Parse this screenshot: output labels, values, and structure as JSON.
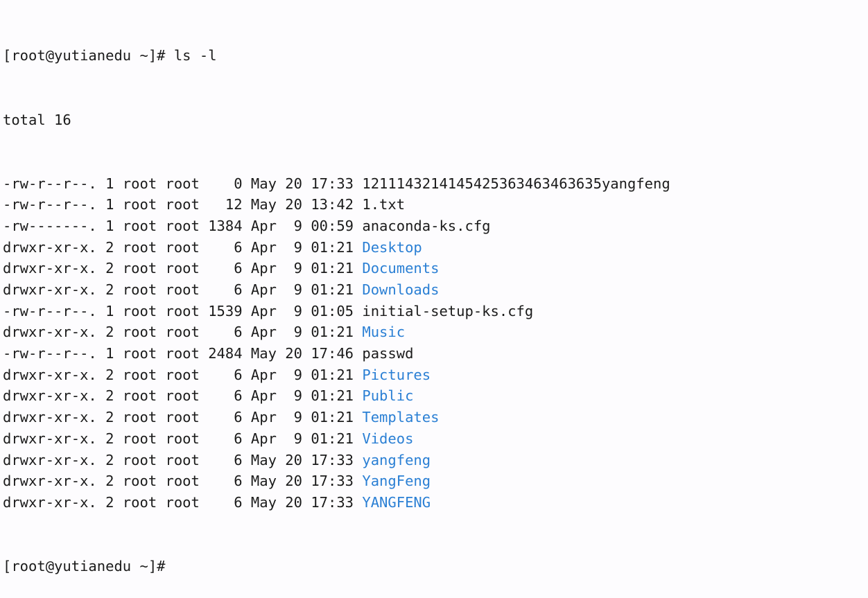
{
  "terminal": {
    "colors": {
      "background": "#fdfcfe",
      "foreground": "#1b1b1b",
      "directory": "#2a7fd4"
    },
    "prompt": "[root@yutianedu ~]#",
    "user": "root",
    "host": "yutianedu",
    "cwd": "~",
    "command": "ls -l",
    "command_line": "[root@yutianedu ~]# ls -l",
    "total_line": "total 16",
    "total_blocks": "16",
    "columns": [
      "permissions",
      "links",
      "owner",
      "group",
      "size",
      "month",
      "day",
      "time",
      "name"
    ],
    "entries": [
      {
        "permissions": "-rw-r--r--.",
        "links": "1",
        "owner": "root",
        "group": "root",
        "size": "0",
        "month": "May",
        "day": "20",
        "time": "17:33",
        "name": "1211143214145425363463463635yangfeng",
        "type": "file"
      },
      {
        "permissions": "-rw-r--r--.",
        "links": "1",
        "owner": "root",
        "group": "root",
        "size": "12",
        "month": "May",
        "day": "20",
        "time": "13:42",
        "name": "1.txt",
        "type": "file"
      },
      {
        "permissions": "-rw-------.",
        "links": "1",
        "owner": "root",
        "group": "root",
        "size": "1384",
        "month": "Apr",
        "day": "9",
        "time": "00:59",
        "name": "anaconda-ks.cfg",
        "type": "file"
      },
      {
        "permissions": "drwxr-xr-x.",
        "links": "2",
        "owner": "root",
        "group": "root",
        "size": "6",
        "month": "Apr",
        "day": "9",
        "time": "01:21",
        "name": "Desktop",
        "type": "dir"
      },
      {
        "permissions": "drwxr-xr-x.",
        "links": "2",
        "owner": "root",
        "group": "root",
        "size": "6",
        "month": "Apr",
        "day": "9",
        "time": "01:21",
        "name": "Documents",
        "type": "dir"
      },
      {
        "permissions": "drwxr-xr-x.",
        "links": "2",
        "owner": "root",
        "group": "root",
        "size": "6",
        "month": "Apr",
        "day": "9",
        "time": "01:21",
        "name": "Downloads",
        "type": "dir"
      },
      {
        "permissions": "-rw-r--r--.",
        "links": "1",
        "owner": "root",
        "group": "root",
        "size": "1539",
        "month": "Apr",
        "day": "9",
        "time": "01:05",
        "name": "initial-setup-ks.cfg",
        "type": "file"
      },
      {
        "permissions": "drwxr-xr-x.",
        "links": "2",
        "owner": "root",
        "group": "root",
        "size": "6",
        "month": "Apr",
        "day": "9",
        "time": "01:21",
        "name": "Music",
        "type": "dir"
      },
      {
        "permissions": "-rw-r--r--.",
        "links": "1",
        "owner": "root",
        "group": "root",
        "size": "2484",
        "month": "May",
        "day": "20",
        "time": "17:46",
        "name": "passwd",
        "type": "file"
      },
      {
        "permissions": "drwxr-xr-x.",
        "links": "2",
        "owner": "root",
        "group": "root",
        "size": "6",
        "month": "Apr",
        "day": "9",
        "time": "01:21",
        "name": "Pictures",
        "type": "dir"
      },
      {
        "permissions": "drwxr-xr-x.",
        "links": "2",
        "owner": "root",
        "group": "root",
        "size": "6",
        "month": "Apr",
        "day": "9",
        "time": "01:21",
        "name": "Public",
        "type": "dir"
      },
      {
        "permissions": "drwxr-xr-x.",
        "links": "2",
        "owner": "root",
        "group": "root",
        "size": "6",
        "month": "Apr",
        "day": "9",
        "time": "01:21",
        "name": "Templates",
        "type": "dir"
      },
      {
        "permissions": "drwxr-xr-x.",
        "links": "2",
        "owner": "root",
        "group": "root",
        "size": "6",
        "month": "Apr",
        "day": "9",
        "time": "01:21",
        "name": "Videos",
        "type": "dir"
      },
      {
        "permissions": "drwxr-xr-x.",
        "links": "2",
        "owner": "root",
        "group": "root",
        "size": "6",
        "month": "May",
        "day": "20",
        "time": "17:33",
        "name": "yangfeng",
        "type": "dir"
      },
      {
        "permissions": "drwxr-xr-x.",
        "links": "2",
        "owner": "root",
        "group": "root",
        "size": "6",
        "month": "May",
        "day": "20",
        "time": "17:33",
        "name": "YangFeng",
        "type": "dir"
      },
      {
        "permissions": "drwxr-xr-x.",
        "links": "2",
        "owner": "root",
        "group": "root",
        "size": "6",
        "month": "May",
        "day": "20",
        "time": "17:33",
        "name": "YANGFENG",
        "type": "dir"
      }
    ],
    "trailing_prompt": "[root@yutianedu ~]#"
  }
}
